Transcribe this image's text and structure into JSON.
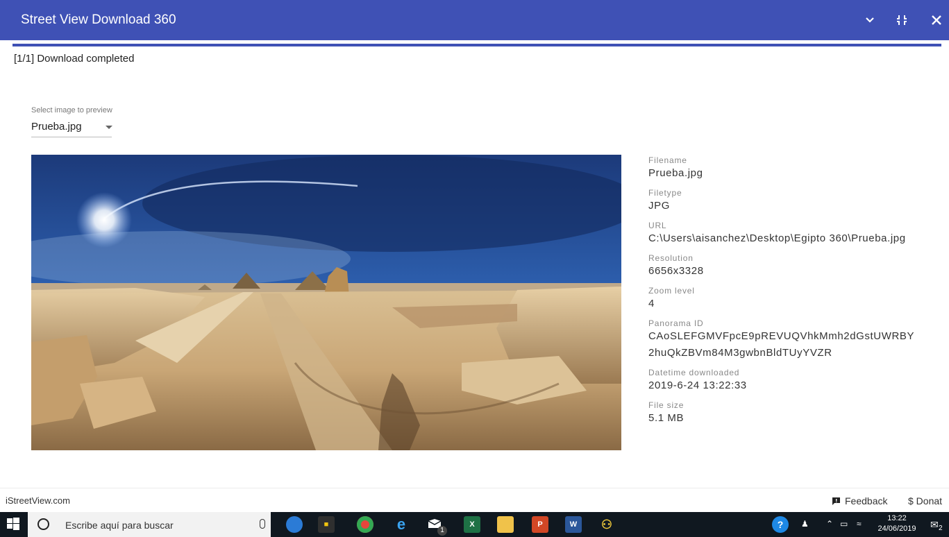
{
  "window": {
    "title": "Street View Download 360"
  },
  "status": "[1/1] Download completed",
  "preview_select": {
    "label": "Select image to preview",
    "selected": "Prueba.jpg"
  },
  "info": {
    "filename_label": "Filename",
    "filename": "Prueba.jpg",
    "filetype_label": "Filetype",
    "filetype": "JPG",
    "url_label": "URL",
    "url": "C:\\Users\\aisanchez\\Desktop\\Egipto 360\\Prueba.jpg",
    "resolution_label": "Resolution",
    "resolution": "6656x3328",
    "zoom_label": "Zoom level",
    "zoom": "4",
    "panorama_id_label": "Panorama ID",
    "panorama_id": "CAoSLEFGMVFpcE9pREVUQVhkMmh2dGstUWRBY2huQkZBVm84M3gwbnBldTUyYVZR",
    "datetime_label": "Datetime downloaded",
    "datetime": "2019-6-24 13:22:33",
    "filesize_label": "File size",
    "filesize": "5.1 MB"
  },
  "footer": {
    "site": "iStreetView.com",
    "feedback": "Feedback",
    "donate": "$ Donat"
  },
  "taskbar": {
    "search_placeholder": "Escribe aquí para buscar",
    "time": "13:22",
    "date": "24/06/2019",
    "notification_count": "2",
    "badge_count": "1"
  },
  "colors": {
    "titlebar": "#3f51b5",
    "taskbar": "#101820"
  }
}
